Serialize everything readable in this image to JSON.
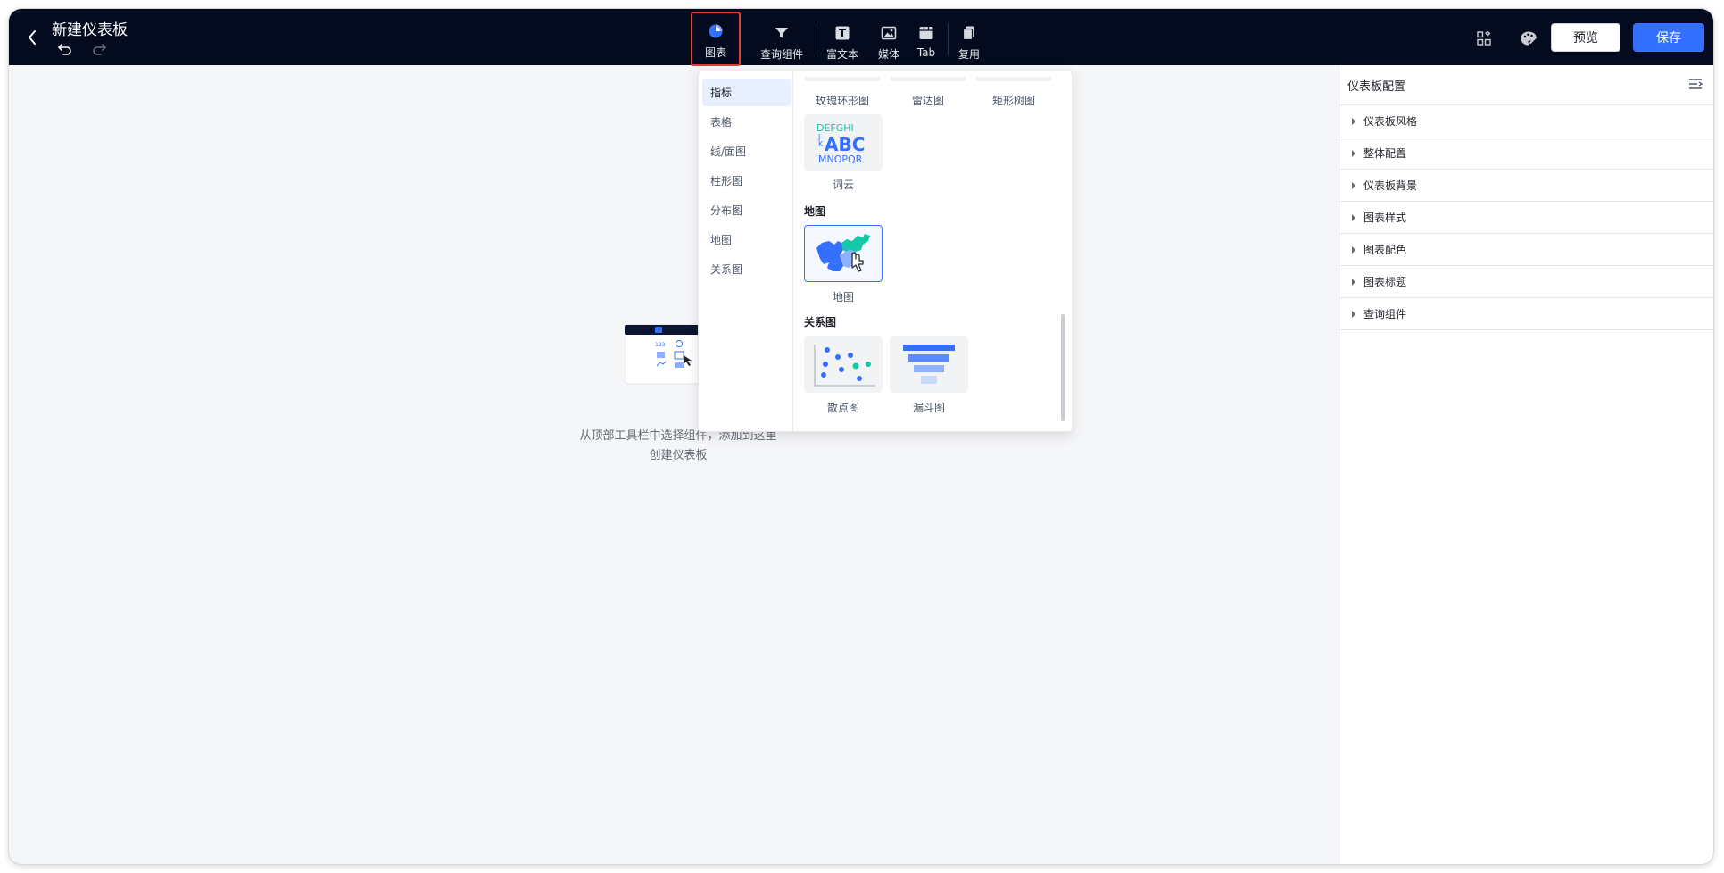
{
  "app": {
    "title": "新建仪表板"
  },
  "toolbar": {
    "items": [
      {
        "label": "图表",
        "icon": "pie-chart-icon"
      },
      {
        "label": "查询组件",
        "icon": "filter-icon"
      },
      {
        "label": "富文本",
        "icon": "text-icon"
      },
      {
        "label": "媒体",
        "icon": "image-icon"
      },
      {
        "label": "Tab",
        "icon": "tab-icon"
      },
      {
        "label": "复用",
        "icon": "copy-icon"
      }
    ],
    "preview_label": "预览",
    "save_label": "保存"
  },
  "picker": {
    "categories": [
      "指标",
      "表格",
      "线/面图",
      "柱形图",
      "分布图",
      "地图",
      "关系图"
    ],
    "top_row": [
      "玫瑰环形图",
      "雷达图",
      "矩形树图"
    ],
    "wordcloud": {
      "label": "词云",
      "text_lines": [
        "DEFGHI",
        "J",
        "K",
        "ABC",
        "MNOPQR"
      ]
    },
    "sections": [
      {
        "title": "地图",
        "items": [
          "地图"
        ]
      },
      {
        "title": "关系图",
        "items": [
          "散点图",
          "漏斗图"
        ]
      }
    ]
  },
  "canvas": {
    "empty_line1": "从顶部工具栏中选择组件，添加到这里",
    "empty_line2": "创建仪表板",
    "illus_number": "123"
  },
  "panel": {
    "title": "仪表板配置",
    "items": [
      "仪表板风格",
      "整体配置",
      "仪表板背景",
      "图表样式",
      "图表配色",
      "图表标题",
      "查询组件"
    ]
  },
  "colors": {
    "accent": "#3370ff",
    "topbar": "#050b1e",
    "highlight_border": "#e03c3c",
    "teal": "#14c9a8"
  }
}
